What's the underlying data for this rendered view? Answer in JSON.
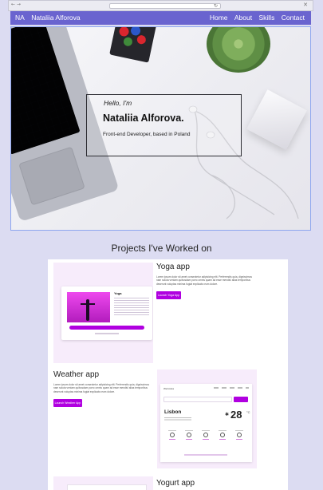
{
  "browser": {
    "nav_arrows": "← →",
    "reload_icon": "reload-icon",
    "close_icon": "close-icon"
  },
  "nav": {
    "brand_short": "NA",
    "brand_name": "Nataliia Alforova",
    "links": [
      "Home",
      "About",
      "Skills",
      "Contact"
    ]
  },
  "hero": {
    "greeting": "Hello, I'm",
    "name": "Nataliia Alforova.",
    "role": "Front-end Developer, based in Poland"
  },
  "projects": {
    "section_title": "Projects I've Worked on",
    "items": [
      {
        "title": "Yoga app",
        "description": "Lorem ipsum dolor sit amet consectetur adipisicing elit. Perferendis quia, dignissimos nam soluta veniam quibusdam porro omnis quam ad esse mendis! alias temporibus deserunt voluptas minima fugiat explicabo eum dolore.",
        "button": "Launch Yoga App",
        "preview_title": "Yoga"
      },
      {
        "title": "Weather app",
        "description": "Lorem ipsum dolor sit amet consectetur adipisicing elit. Perferendis quia, dignissimos nam soluta veniam quibusdam porro omnis quam ad esse mendis! alias temporibus deserunt voluptas minima fugiat explicabo eum dolore.",
        "button": "Launch Weather App",
        "preview_brand": "WeCodes",
        "preview_city": "Lisbon",
        "preview_temp": "28",
        "preview_unit": "°C"
      },
      {
        "title": "Yogurt app"
      }
    ]
  },
  "colors": {
    "nav_bg": "#6a64cf",
    "accent": "#b000e0",
    "page_bg": "#dcdcf2",
    "hero_border": "#8ea6ef"
  }
}
